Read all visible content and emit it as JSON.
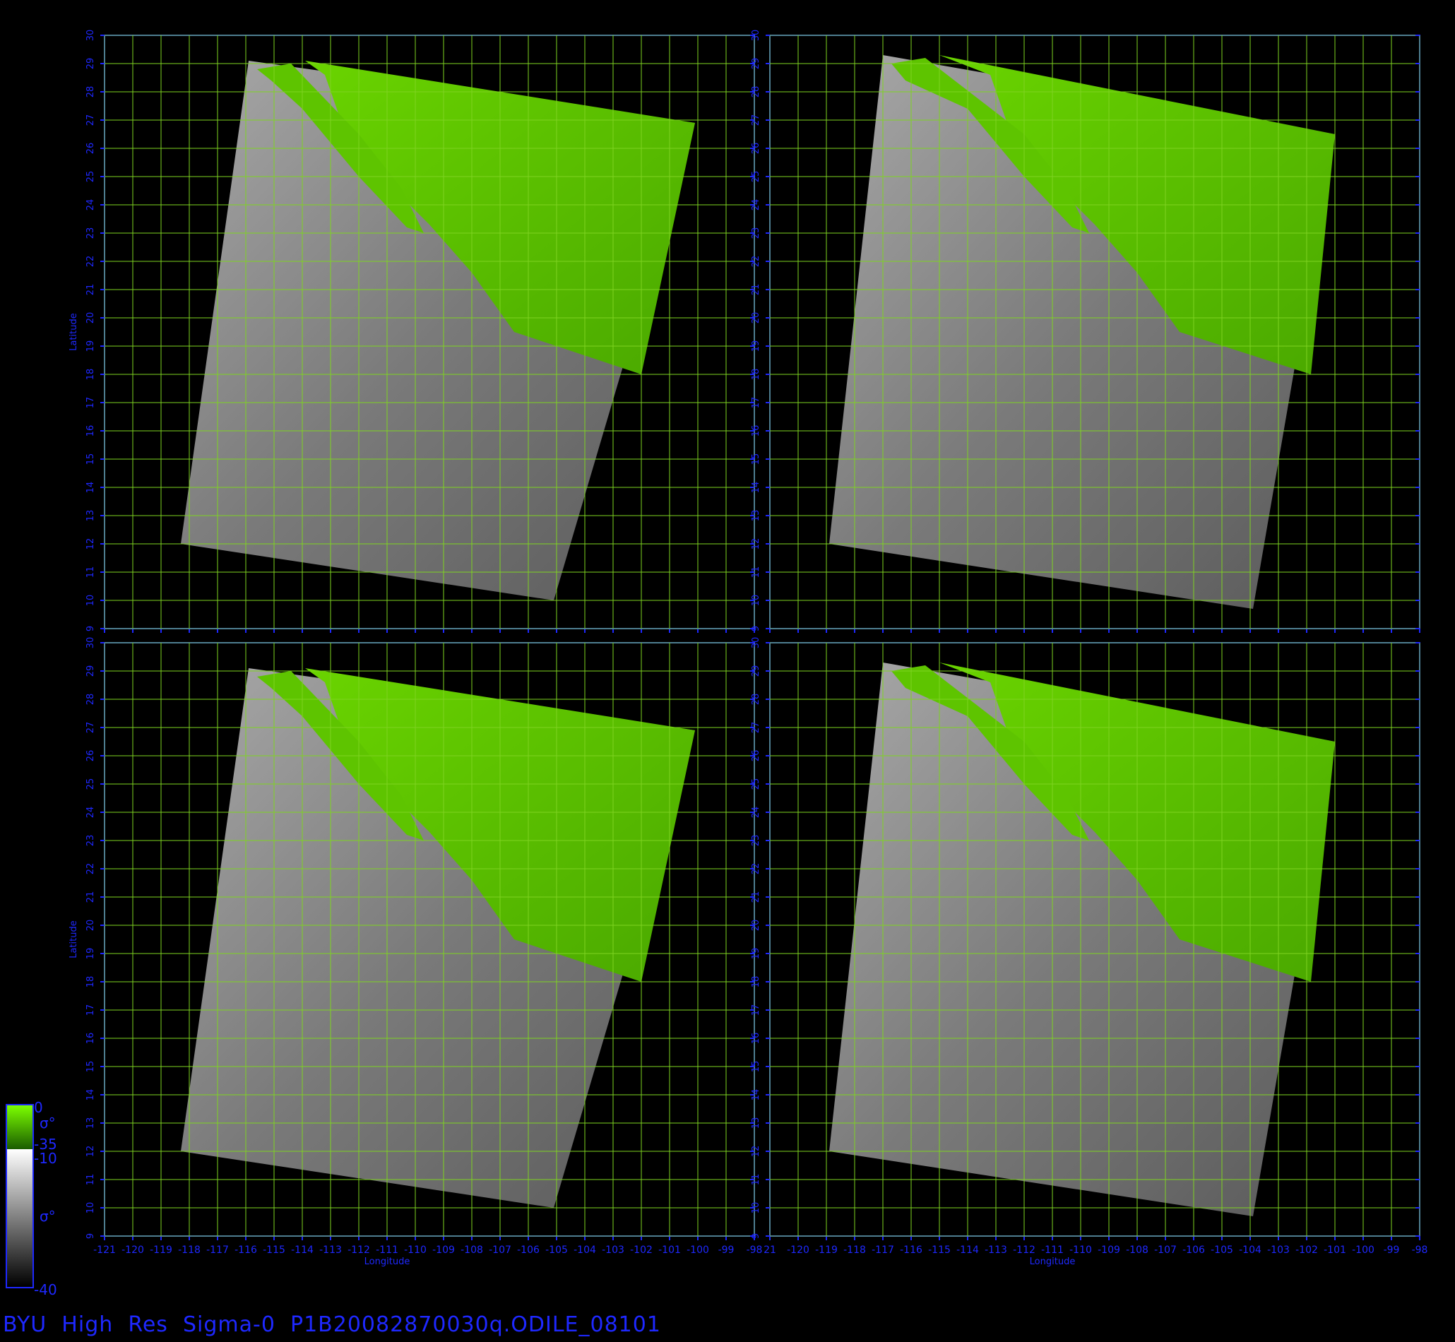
{
  "title": "BYU  High  Res  Sigma-0  P1B20082870030q.ODILE_08101",
  "axes": {
    "xlabel": "Longitude",
    "ylabel": "Latitude",
    "lon_ticks_left": [
      "-121",
      "-120",
      "-119",
      "-118",
      "-117",
      "-116",
      "-115",
      "-114",
      "-113",
      "-112",
      "-111",
      "-110",
      "-109",
      "-108",
      "-107",
      "-106",
      "-105",
      "-104",
      "-103",
      "-102",
      "-101",
      "-100",
      "-99",
      "-98"
    ],
    "lon_ticks_right": [
      "21",
      "-120",
      "-119",
      "-118",
      "-117",
      "-116",
      "-115",
      "-114",
      "-113",
      "-112",
      "-111",
      "-110",
      "-109",
      "-108",
      "-107",
      "-106",
      "-105",
      "-104",
      "-103",
      "-102",
      "-101",
      "-100",
      "-99",
      "-98"
    ],
    "lat_ticks": [
      "9",
      "10",
      "11",
      "12",
      "13",
      "14",
      "15",
      "16",
      "17",
      "18",
      "19",
      "20",
      "21",
      "22",
      "23",
      "24",
      "25",
      "26",
      "27",
      "28",
      "29",
      "30"
    ],
    "lon_range": [
      -121,
      -98
    ],
    "lat_range": [
      9,
      30
    ]
  },
  "colors": {
    "axis": "#1e28ff",
    "grid": "#7ed321",
    "land": "#5ec400",
    "background": "#000000"
  },
  "legend": {
    "land_top": "0",
    "land_sigma": "σ°",
    "land_bottom": "-35",
    "ocean_top": "-10",
    "ocean_sigma": "σ°",
    "ocean_bottom": "-40"
  },
  "panels": [
    {
      "id": "top-left",
      "swath": [
        [
          -115.9,
          29.1
        ],
        [
          -100.1,
          26.9
        ],
        [
          -105.1,
          10.0
        ],
        [
          -118.3,
          12.0
        ]
      ]
    },
    {
      "id": "top-right",
      "swath": [
        [
          -117.0,
          29.3
        ],
        [
          -101.0,
          26.5
        ],
        [
          -103.9,
          9.7
        ],
        [
          -118.9,
          12.0
        ]
      ]
    },
    {
      "id": "bottom-left",
      "swath": [
        [
          -115.9,
          29.1
        ],
        [
          -100.1,
          26.9
        ],
        [
          -105.1,
          10.0
        ],
        [
          -118.3,
          12.0
        ]
      ]
    },
    {
      "id": "bottom-right",
      "swath": [
        [
          -117.0,
          29.3
        ],
        [
          -101.0,
          26.5
        ],
        [
          -103.9,
          9.7
        ],
        [
          -118.9,
          12.0
        ]
      ]
    }
  ]
}
